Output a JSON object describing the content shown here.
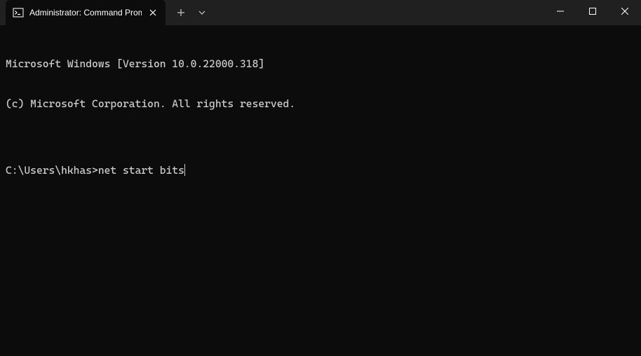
{
  "titlebar": {
    "tab": {
      "title": "Administrator: Command Promp"
    }
  },
  "terminal": {
    "line1": "Microsoft Windows [Version 10.0.22000.318]",
    "line2": "(c) Microsoft Corporation. All rights reserved.",
    "blank": "",
    "prompt": "C:\\Users\\hkhas>",
    "command": "net start bits"
  }
}
